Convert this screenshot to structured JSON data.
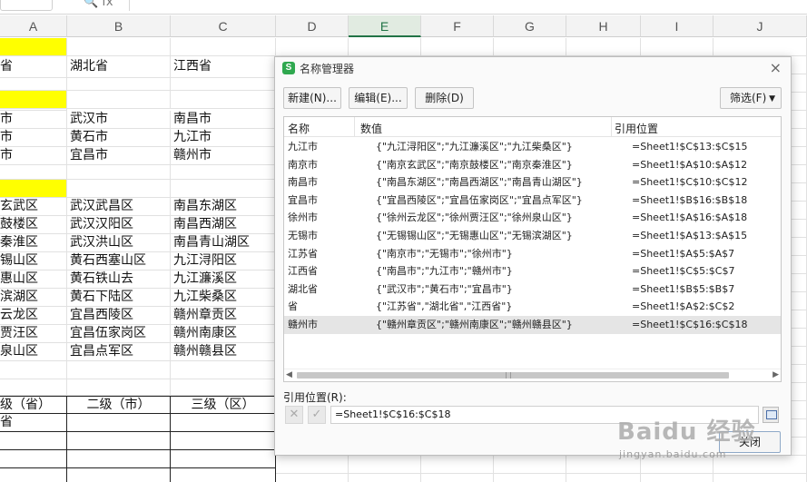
{
  "formula_bar": {
    "fx_icons": "🔍 fx"
  },
  "columns": [
    "A",
    "B",
    "C",
    "D",
    "E",
    "F",
    "G",
    "H",
    "I",
    "J"
  ],
  "active_column": "E",
  "cells": {
    "r2": [
      "省",
      "湖北省",
      "江西省"
    ],
    "r4": [
      "市",
      "武汉市",
      "南昌市"
    ],
    "r5": [
      "市",
      "黄石市",
      "九江市"
    ],
    "r6": [
      "市",
      "宜昌市",
      "赣州市"
    ],
    "r8": [
      "玄武区",
      "武汉武昌区",
      "南昌东湖区"
    ],
    "r9": [
      "鼓楼区",
      "武汉汉阳区",
      "南昌西湖区"
    ],
    "r10": [
      "秦淮区",
      "武汉洪山区",
      "南昌青山湖区"
    ],
    "r11": [
      "锡山区",
      "黄石西塞山区",
      "九江浔阳区"
    ],
    "r12": [
      "惠山区",
      "黄石铁山去",
      "九江濂溪区"
    ],
    "r13": [
      "滨湖区",
      "黄石下陆区",
      "九江柴桑区"
    ],
    "r14": [
      "云龙区",
      "宜昌西陵区",
      "赣州章贡区"
    ],
    "r15": [
      "贾汪区",
      "宜昌伍家岗区",
      "赣州南康区"
    ],
    "r16": [
      "泉山区",
      "宜昌点军区",
      "赣州赣县区"
    ],
    "r18": [
      "级（省）",
      "二级（市）",
      "三级（区）"
    ],
    "r19": [
      "省",
      "",
      ""
    ]
  },
  "dialog": {
    "title": "名称管理器",
    "app_icon": "S",
    "close": "×",
    "buttons": {
      "new": "新建(N)...",
      "edit": "编辑(E)...",
      "delete": "删除(D)",
      "filter": "筛选(F)",
      "close": "关闭"
    },
    "list_headers": {
      "name": "名称",
      "value": "数值",
      "ref": "引用位置"
    },
    "rows": [
      {
        "name": "九江市",
        "value": "{\"九江浔阳区\";\"九江濂溪区\";\"九江柴桑区\"}",
        "ref": "=Sheet1!$C$13:$C$15"
      },
      {
        "name": "南京市",
        "value": "{\"南京玄武区\";\"南京鼓楼区\";\"南京秦淮区\"}",
        "ref": "=Sheet1!$A$10:$A$12"
      },
      {
        "name": "南昌市",
        "value": "{\"南昌东湖区\";\"南昌西湖区\";\"南昌青山湖区\"}",
        "ref": "=Sheet1!$C$10:$C$12"
      },
      {
        "name": "宜昌市",
        "value": "{\"宜昌西陵区\";\"宜昌伍家岗区\";\"宜昌点军区\"}",
        "ref": "=Sheet1!$B$16:$B$18"
      },
      {
        "name": "徐州市",
        "value": "{\"徐州云龙区\";\"徐州贾汪区\";\"徐州泉山区\"}",
        "ref": "=Sheet1!$A$16:$A$18"
      },
      {
        "name": "无锡市",
        "value": "{\"无锡锡山区\";\"无锡惠山区\";\"无锡滨湖区\"}",
        "ref": "=Sheet1!$A$13:$A$15"
      },
      {
        "name": "江苏省",
        "value": "{\"南京市\";\"无锡市\";\"徐州市\"}",
        "ref": "=Sheet1!$A$5:$A$7"
      },
      {
        "name": "江西省",
        "value": "{\"南昌市\";\"九江市\";\"赣州市\"}",
        "ref": "=Sheet1!$C$5:$C$7"
      },
      {
        "name": "湖北省",
        "value": "{\"武汉市\";\"黄石市\";\"宜昌市\"}",
        "ref": "=Sheet1!$B$5:$B$7"
      },
      {
        "name": "省",
        "value": "{\"江苏省\",\"湖北省\",\"江西省\"}",
        "ref": "=Sheet1!$A$2:$C$2"
      },
      {
        "name": "赣州市",
        "value": "{\"赣州章贡区\";\"赣州南康区\";\"赣州赣县区\"}",
        "ref": "=Sheet1!$C$16:$C$18"
      }
    ],
    "selected_index": 10,
    "ref_label": "引用位置(R):",
    "ref_value": "=Sheet1!$C$16:$C$18",
    "cancel_glyph": "✕",
    "confirm_glyph": "✓"
  },
  "watermark": {
    "main": "Baidu 经验",
    "sub": "jingyan.baidu.com"
  },
  "colors": {
    "highlight": "#ffff00",
    "active_col": "#217346",
    "selected_row": "#e5e5e5"
  }
}
